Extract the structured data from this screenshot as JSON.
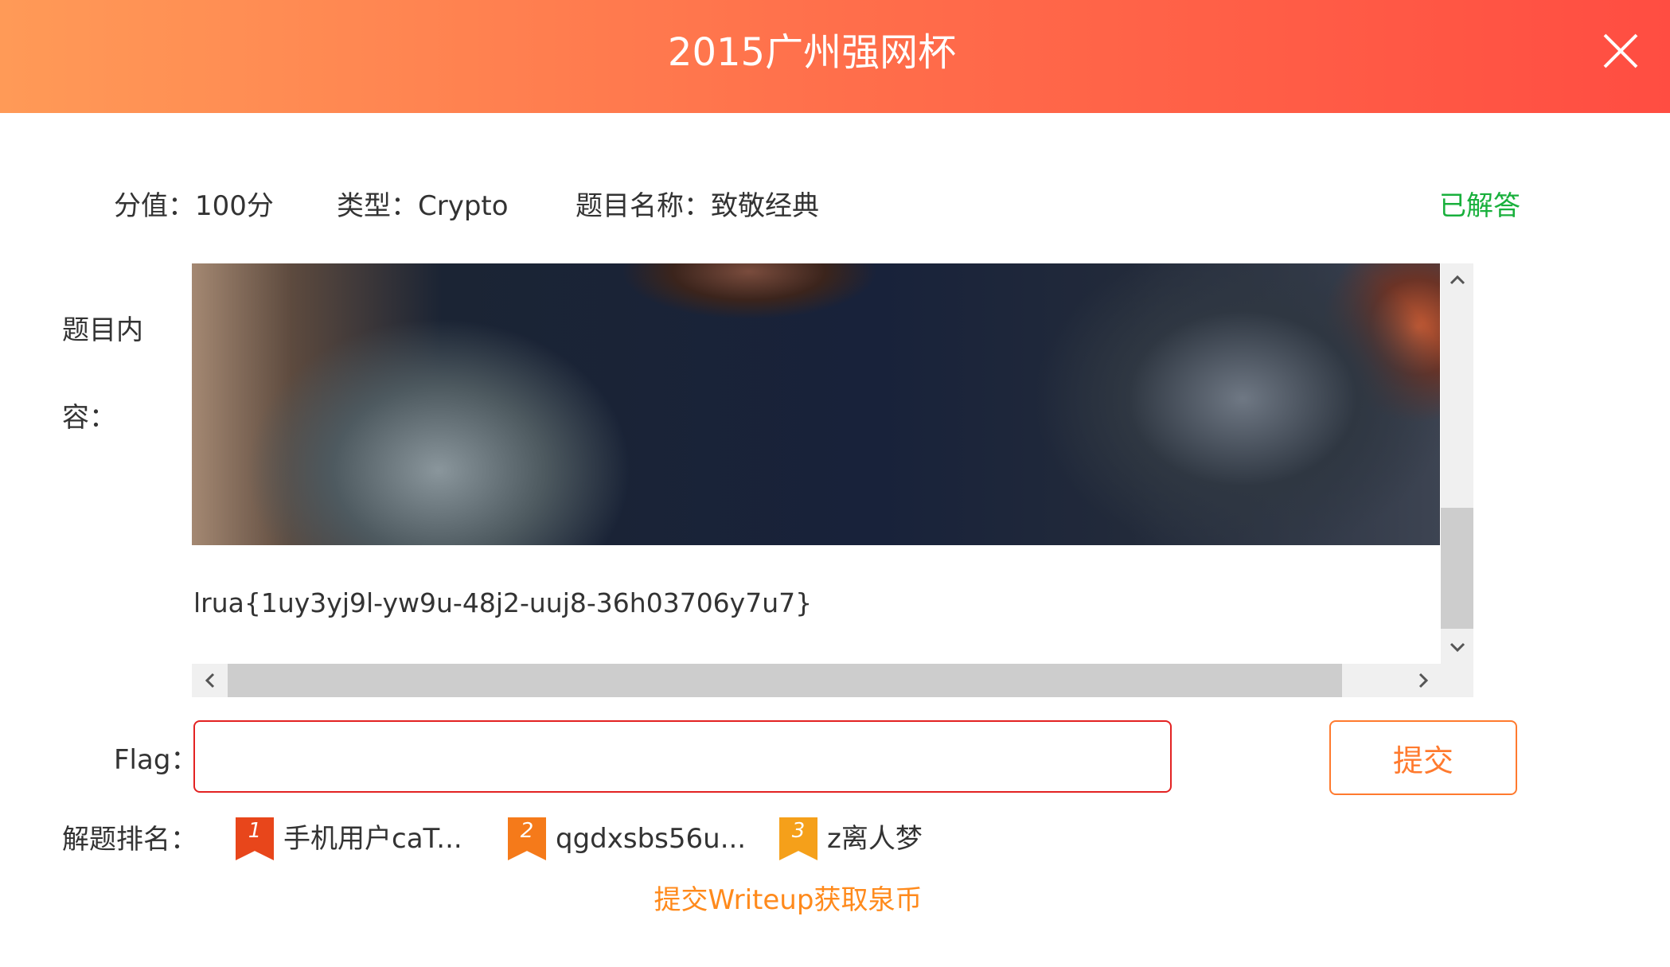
{
  "header": {
    "title": "2015广州强网杯"
  },
  "meta": {
    "score": "分值：100分",
    "type": "类型：Crypto",
    "name": "题目名称：致敬经典",
    "status": "已解答"
  },
  "content": {
    "label": "题目内容：",
    "label_line1": "题目内",
    "label_line2": "容：",
    "text": "lrua{1uy3yj9l-yw9u-48j2-uuj8-36h03706y7u7}"
  },
  "flag": {
    "label": "Flag：",
    "value": "",
    "placeholder": ""
  },
  "submit": {
    "label": "提交"
  },
  "ranking": {
    "label": "解题排名：",
    "items": [
      {
        "rank": "1",
        "name": "手机用户caT...",
        "color": "#e8461b"
      },
      {
        "rank": "2",
        "name": "qgdxsbs56u...",
        "color": "#f57a1a"
      },
      {
        "rank": "3",
        "name": "z离人梦",
        "color": "#f5a01a"
      }
    ]
  },
  "writeup": {
    "label": "提交Writeup获取泉币"
  },
  "colors": {
    "header_start": "#ff9a57",
    "header_end": "#ff4d42",
    "status_green": "#19b03c",
    "accent_orange": "#ff7a2e",
    "input_border": "#e32222"
  }
}
